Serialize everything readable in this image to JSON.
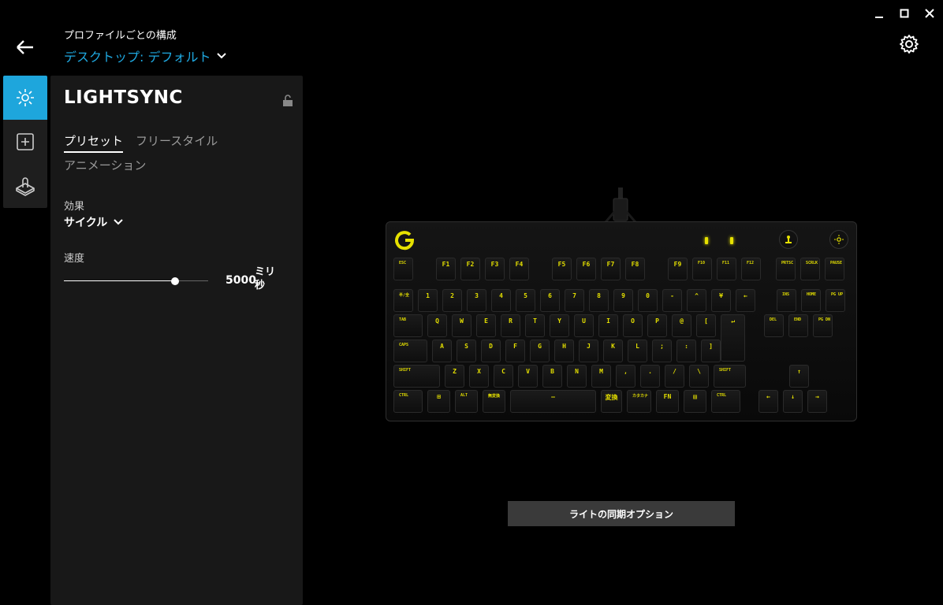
{
  "header": {
    "profile_caption": "プロファイルごとの構成",
    "profile_name": "デスクトップ: デフォルト"
  },
  "panel": {
    "title": "LIGHTSYNC",
    "tabs": [
      {
        "label": "プリセット",
        "active": true
      },
      {
        "label": "フリースタイル",
        "active": false
      },
      {
        "label": "アニメーション",
        "active": false
      }
    ],
    "effect": {
      "label": "効果",
      "value": "サイクル"
    },
    "speed": {
      "label": "速度",
      "value": "5000",
      "unit": "ミリ秒",
      "fraction": 0.77
    }
  },
  "nav": [
    {
      "icon": "lighting-icon",
      "active": true
    },
    {
      "icon": "add-assignment-icon",
      "active": false
    },
    {
      "icon": "game-mode-icon",
      "active": false
    }
  ],
  "keyboard": {
    "accent_color": "#e6e100",
    "rows": [
      [
        "ESC",
        "",
        "F1",
        "F2",
        "F3",
        "F4",
        "",
        "F5",
        "F6",
        "F7",
        "F8",
        "",
        "F9",
        "F10",
        "F11",
        "F12",
        "",
        "PRTSC",
        "SCRLK",
        "PAUSE"
      ],
      [
        "半/全",
        "1",
        "2",
        "3",
        "4",
        "5",
        "6",
        "7",
        "8",
        "9",
        "0",
        "-",
        "^",
        "¥",
        "←",
        "",
        "INS",
        "HOME",
        "PG UP"
      ],
      [
        "TAB",
        "Q",
        "W",
        "E",
        "R",
        "T",
        "Y",
        "U",
        "I",
        "O",
        "P",
        "@",
        "[",
        "↵",
        "",
        "DEL",
        "END",
        "PG DN"
      ],
      [
        "CAPS",
        "A",
        "S",
        "D",
        "F",
        "G",
        "H",
        "J",
        "K",
        "L",
        ";",
        ":",
        "]"
      ],
      [
        "SHIFT",
        "Z",
        "X",
        "C",
        "V",
        "B",
        "N",
        "M",
        ",",
        ".",
        "/",
        "\\",
        "SHIFT",
        "",
        "↑"
      ],
      [
        "CTRL",
        "⊞",
        "ALT",
        "無変換",
        "—",
        "変換",
        "カタカナ",
        "FN",
        "▤",
        "CTRL",
        "",
        "←",
        "↓",
        "→"
      ]
    ]
  },
  "sync_button": {
    "label": "ライトの同期オプション"
  },
  "colors": {
    "accent": "#1ea6dc",
    "panel": "#181818",
    "key_legend": "#e6e100"
  }
}
